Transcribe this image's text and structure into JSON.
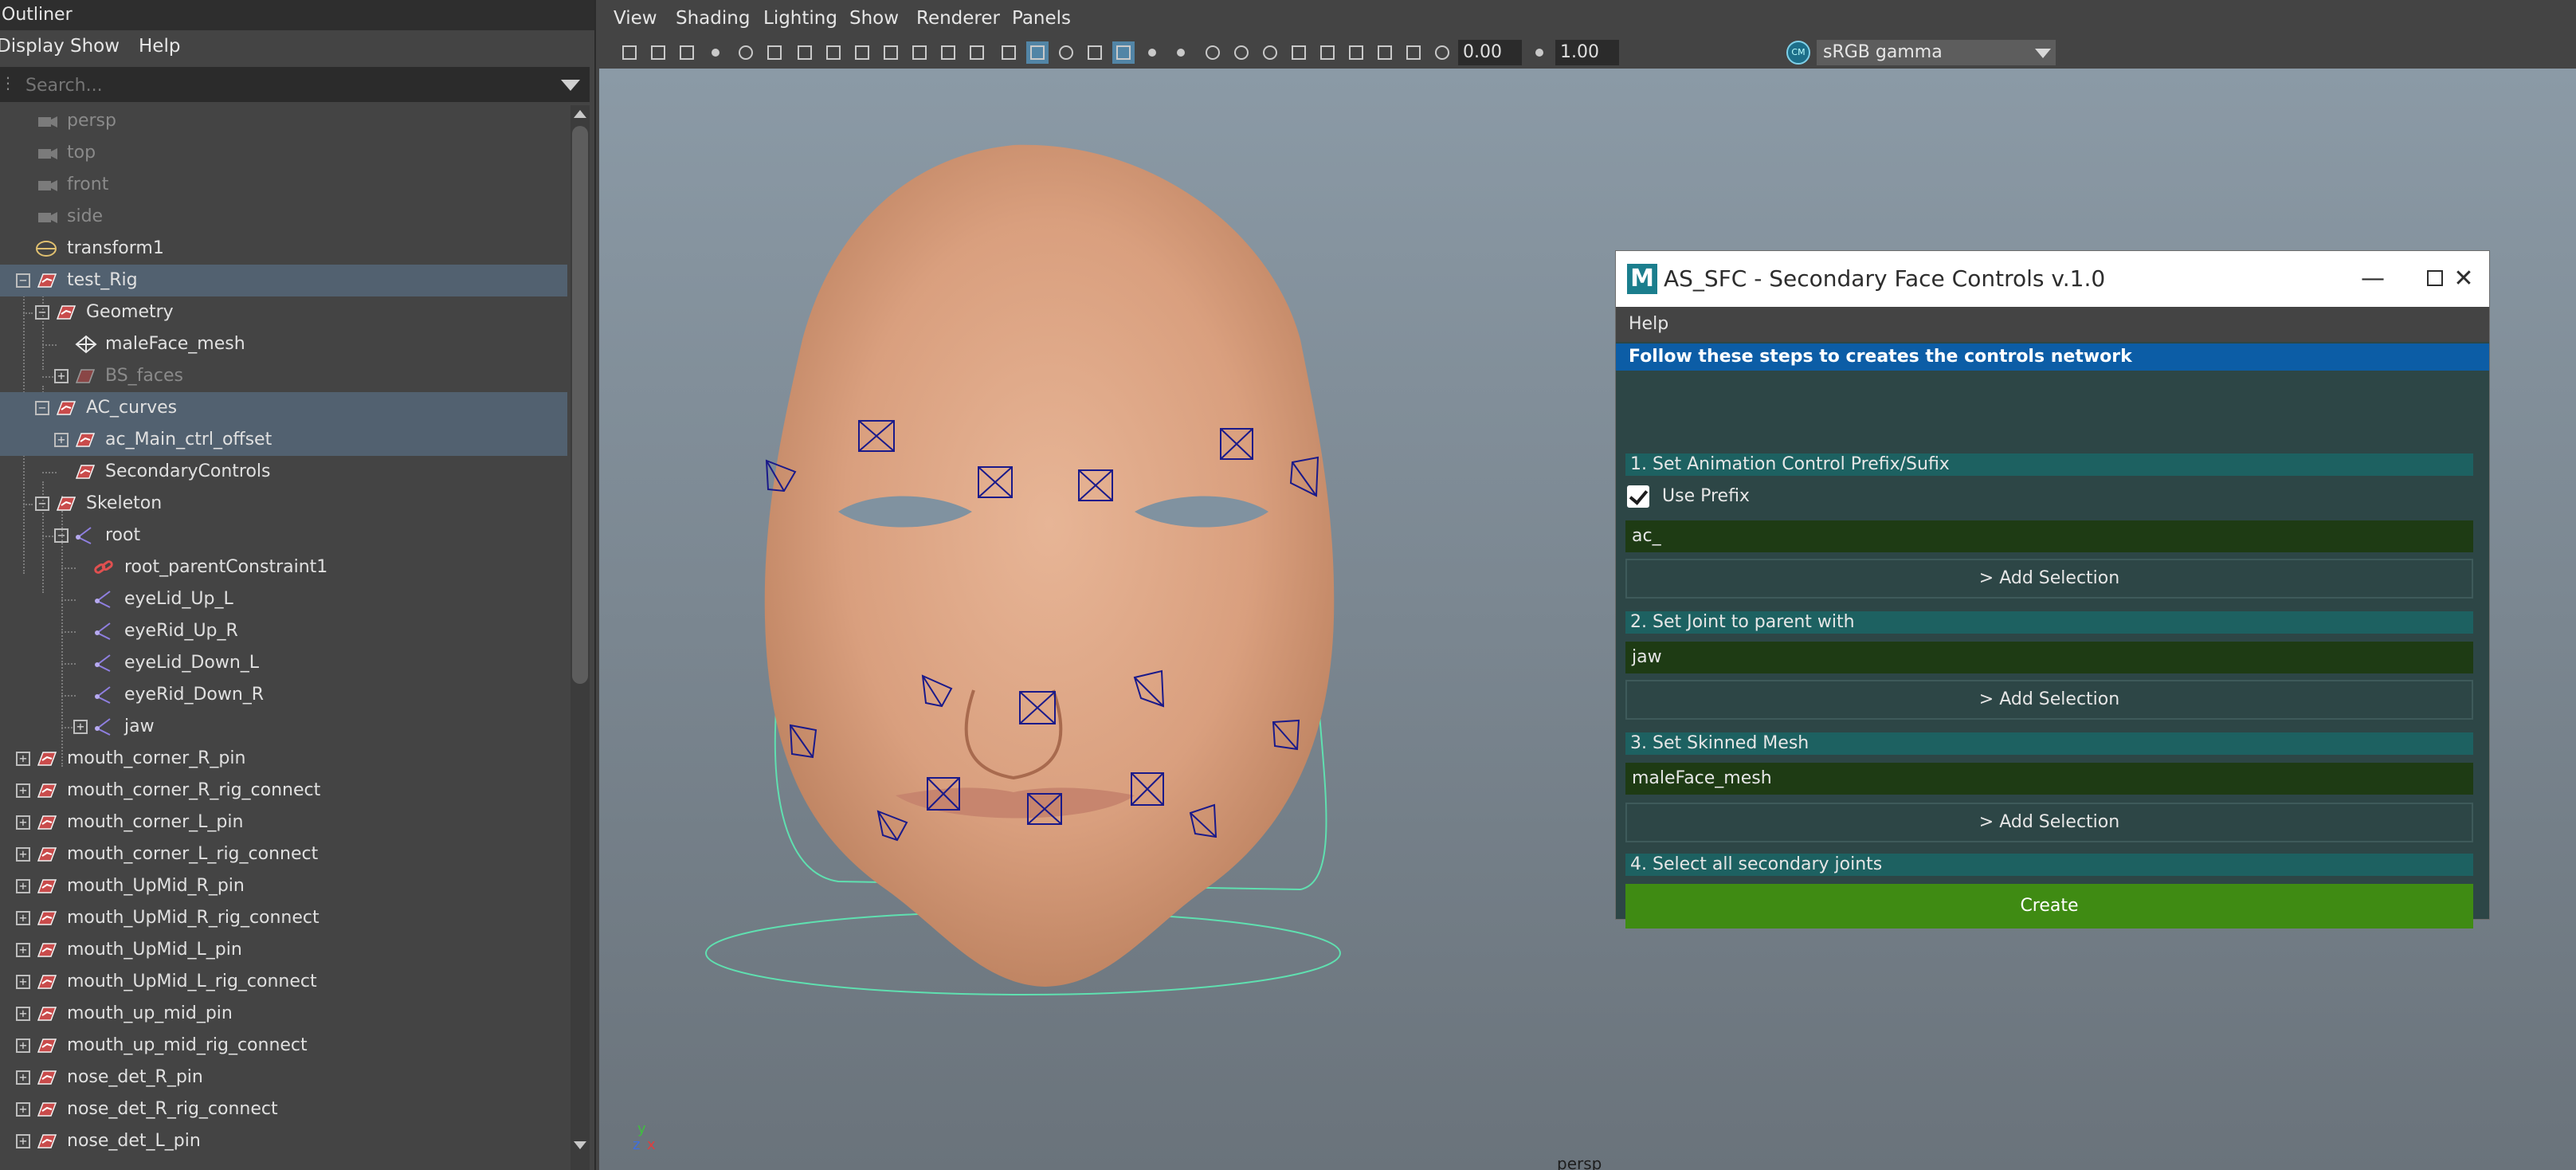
{
  "outliner": {
    "title": "Outliner",
    "menu": [
      "Display",
      "Show",
      "Help"
    ],
    "search_placeholder": "Search...",
    "items": [
      {
        "label": "persp"
      },
      {
        "label": "top"
      },
      {
        "label": "front"
      },
      {
        "label": "side"
      },
      {
        "label": "transform1"
      },
      {
        "label": "test_Rig"
      },
      {
        "label": "Geometry"
      },
      {
        "label": "maleFace_mesh"
      },
      {
        "label": "BS_faces"
      },
      {
        "label": "AC_curves"
      },
      {
        "label": "ac_Main_ctrl_offset"
      },
      {
        "label": "SecondaryControls"
      },
      {
        "label": "Skeleton"
      },
      {
        "label": "root"
      },
      {
        "label": "root_parentConstraint1"
      },
      {
        "label": "eyeLid_Up_L"
      },
      {
        "label": "eyeRid_Up_R"
      },
      {
        "label": "eyeLid_Down_L"
      },
      {
        "label": "eyeRid_Down_R"
      },
      {
        "label": "jaw"
      },
      {
        "label": "mouth_corner_R_pin"
      },
      {
        "label": "mouth_corner_R_rig_connect"
      },
      {
        "label": "mouth_corner_L_pin"
      },
      {
        "label": "mouth_corner_L_rig_connect"
      },
      {
        "label": "mouth_UpMid_R_pin"
      },
      {
        "label": "mouth_UpMid_R_rig_connect"
      },
      {
        "label": "mouth_UpMid_L_pin"
      },
      {
        "label": "mouth_UpMid_L_rig_connect"
      },
      {
        "label": "mouth_up_mid_pin"
      },
      {
        "label": "mouth_up_mid_rig_connect"
      },
      {
        "label": "nose_det_R_pin"
      },
      {
        "label": "nose_det_R_rig_connect"
      },
      {
        "label": "nose_det_L_pin"
      }
    ]
  },
  "viewport": {
    "menu": [
      "View",
      "Shading",
      "Lighting",
      "Show",
      "Renderer",
      "Panels"
    ],
    "exposure": "0.00",
    "gamma": "1.00",
    "color_space": "sRGB gamma",
    "camera_label": "persp",
    "axis_y": "y",
    "axis_z": "z",
    "axis_x": "x"
  },
  "dialog": {
    "logo": "M",
    "title": "AS_SFC - Secondary Face Controls v.1.0",
    "menu_help": "Help",
    "banner": "Follow these steps to creates the controls network",
    "step1": "1. Set Animation Control Prefix/Sufix",
    "use_prefix": "Use Prefix",
    "prefix_value": "ac_",
    "add_selection": "> Add Selection",
    "step2": "2. Set Joint to parent with",
    "joint_value": "jaw",
    "step3": "3. Set Skinned Mesh",
    "mesh_value": "maleFace_mesh",
    "step4": "4. Select all secondary joints",
    "create": "Create"
  },
  "colors": {
    "selection": "#526170",
    "banner": "#0c5da6",
    "step_header": "#1d6161",
    "field": "#1e3b14",
    "create_button": "#3f8b13",
    "dialog_bg": "#2d4646"
  }
}
